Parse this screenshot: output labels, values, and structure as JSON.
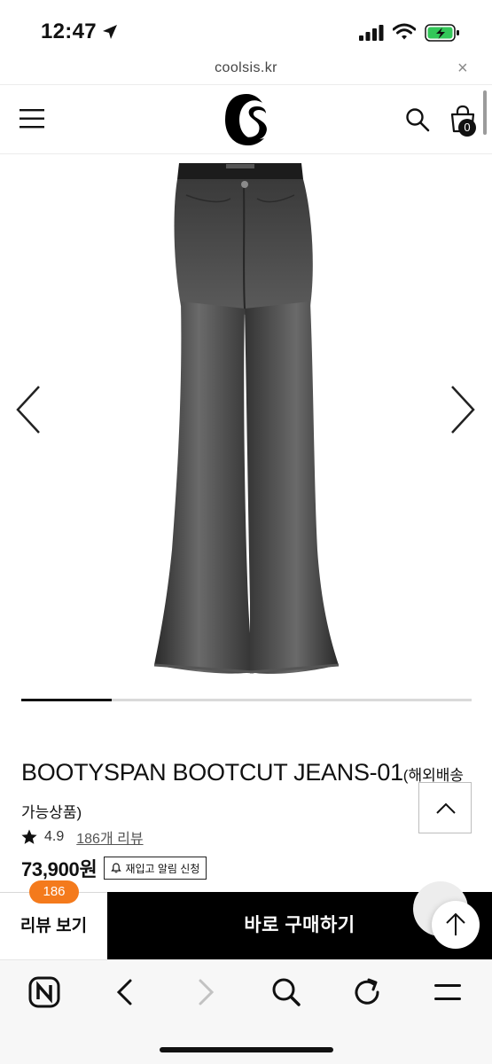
{
  "status_bar": {
    "time": "12:47",
    "icons": [
      "location-arrow-icon",
      "cellular-signal-icon",
      "wifi-icon",
      "battery-charging-icon"
    ]
  },
  "url_bar": {
    "domain": "coolsis.kr",
    "close_icon": "close-icon"
  },
  "header": {
    "menu_icon": "hamburger-menu-icon",
    "logo_icon": "coolsis-logo-icon",
    "search_icon": "search-icon",
    "cart_icon": "shopping-bag-icon",
    "cart_count": "0"
  },
  "gallery": {
    "image": "black-flared-jeans",
    "prev_icon": "chevron-left-icon",
    "next_icon": "chevron-right-icon",
    "progress": 0.2
  },
  "product": {
    "title": "BOOTYSPAN BOOTCUT JEANS-01",
    "title_suffix": "(해외배송 가능상품)",
    "rating": "4.9",
    "review_link": "186개 리뷰",
    "price": "73,900원",
    "restock_label": "재입고 알림 신청"
  },
  "action_bar": {
    "review_count": "186",
    "review_label": "리뷰 보기",
    "buy_label": "바로 구매하기"
  },
  "floating": {
    "scroll_top_square_icon": "chevron-up-icon",
    "chat_icon": "chat-bubble-icon",
    "scroll_top_circle_icon": "arrow-up-icon"
  },
  "browser_toolbar": {
    "icons": [
      "naver-home-icon",
      "back-icon",
      "forward-icon",
      "search-icon",
      "refresh-icon",
      "menu-icon"
    ]
  },
  "colors": {
    "accent_orange": "#f47a1c",
    "primary_black": "#000000"
  }
}
